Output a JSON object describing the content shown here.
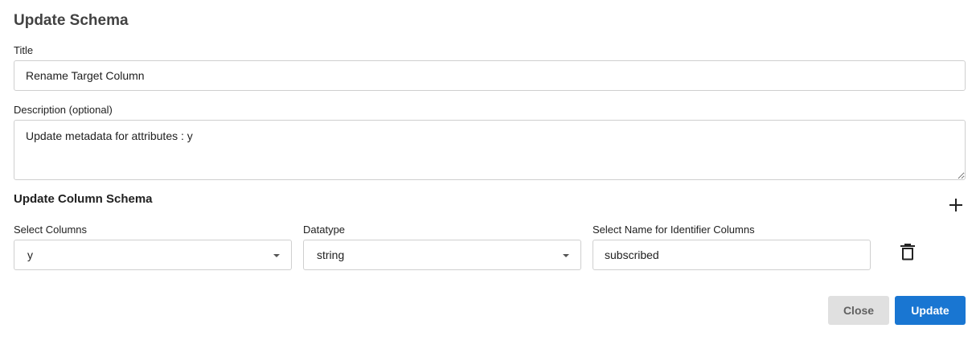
{
  "dialog": {
    "title": "Update Schema"
  },
  "title_field": {
    "label": "Title",
    "value": "Rename Target Column"
  },
  "description_field": {
    "label": "Description (optional)",
    "value": "Update metadata for attributes : y"
  },
  "column_schema": {
    "heading": "Update Column Schema",
    "add_icon": "plus-icon",
    "columns_select": {
      "label": "Select Columns",
      "value": "y"
    },
    "datatype_select": {
      "label": "Datatype",
      "value": "string"
    },
    "identifier_field": {
      "label": "Select Name for Identifier Columns",
      "value": "subscribed"
    },
    "delete_icon": "trash-icon"
  },
  "actions": {
    "close_label": "Close",
    "update_label": "Update"
  },
  "colors": {
    "primary": "#1976d2",
    "secondary_bg": "#e0e0e0"
  }
}
